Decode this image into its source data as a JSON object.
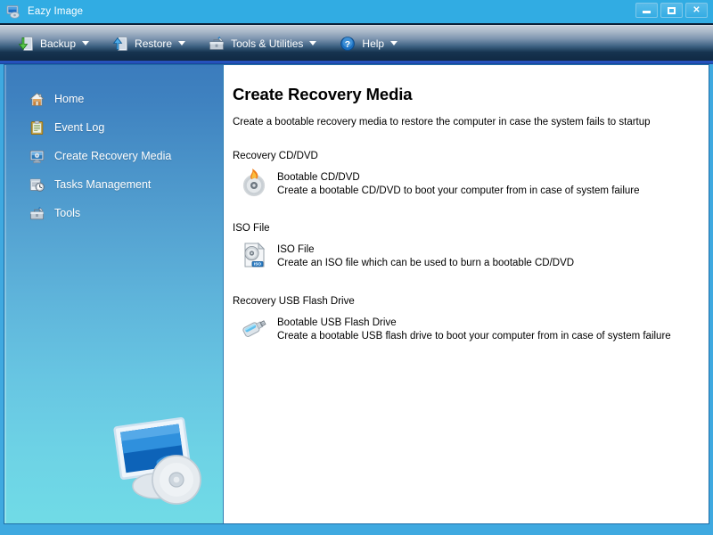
{
  "window": {
    "title": "Eazy Image",
    "title_icon": "app-monitor-disc-icon",
    "buttons": {
      "minimize": "minimize-button",
      "maximize": "maximize-button",
      "close_label": "✕"
    }
  },
  "toolbar": {
    "items": [
      {
        "label": "Backup",
        "icon": "backup-down-arrow-icon",
        "has_caret": true
      },
      {
        "label": "Restore",
        "icon": "restore-up-arrow-icon",
        "has_caret": true
      },
      {
        "label": "Tools & Utilities",
        "icon": "toolbox-icon",
        "has_caret": true
      },
      {
        "label": "Help",
        "icon": "help-question-icon",
        "has_caret": true
      }
    ]
  },
  "sidebar": {
    "items": [
      {
        "label": "Home",
        "icon": "home-icon"
      },
      {
        "label": "Event Log",
        "icon": "clipboard-log-icon"
      },
      {
        "label": "Create Recovery Media",
        "icon": "monitor-media-icon"
      },
      {
        "label": "Tasks Management",
        "icon": "tasks-clock-icon"
      },
      {
        "label": "Tools",
        "icon": "toolbox-icon"
      }
    ],
    "watermark_icon": "monitor-disc-watermark"
  },
  "main": {
    "title": "Create Recovery Media",
    "subtitle": "Create a bootable recovery media to restore the computer in case the system fails to startup",
    "sections": [
      {
        "heading": "Recovery CD/DVD",
        "option": {
          "icon": "burn-cd-dvd-icon",
          "title": "Bootable CD/DVD",
          "desc": "Create a bootable CD/DVD to boot your computer from in case of system failure"
        }
      },
      {
        "heading": "ISO File",
        "option": {
          "icon": "iso-file-icon",
          "title": "ISO File",
          "desc": "Create an ISO file which can be used to burn a bootable CD/DVD"
        }
      },
      {
        "heading": "Recovery USB Flash Drive",
        "option": {
          "icon": "usb-flash-drive-icon",
          "title": "Bootable USB Flash Drive",
          "desc": "Create a bootable USB flash drive to boot your computer from in case of system failure"
        }
      }
    ]
  },
  "colors": {
    "titlebar": "#31ace3",
    "toolbar_top": "#c3cdd8",
    "toolbar_bottom": "#102a44",
    "toolbar_accent": "#2458c9",
    "sidebar_top": "#3b7cbd",
    "sidebar_bottom": "#70dbe6",
    "content_bg": "#ffffff",
    "text": "#000000",
    "nav_text": "#ffffff"
  }
}
